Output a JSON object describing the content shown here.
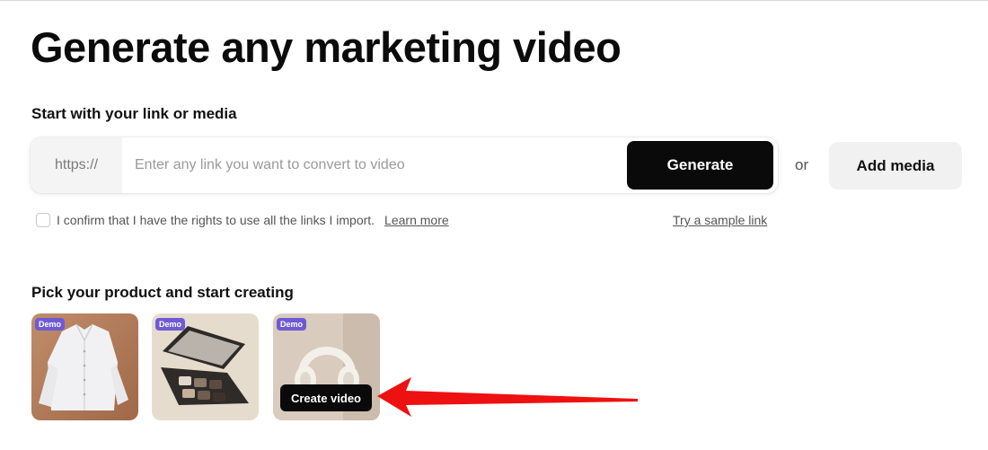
{
  "page": {
    "title": "Generate any marketing video"
  },
  "link_section": {
    "label": "Start with your link or media",
    "prefix": "https://",
    "input_placeholder": "Enter any link you want to convert to video",
    "input_value": "",
    "generate_label": "Generate",
    "or_text": "or",
    "add_media_label": "Add media",
    "confirm_text": "I confirm that I have the rights to use all the links I import.",
    "learn_more_label": "Learn more",
    "sample_link_label": "Try a sample link"
  },
  "products": {
    "label": "Pick your product and start creating",
    "items": [
      {
        "name": "shirt",
        "badge": "Demo",
        "icon": "shirt-thumbnail"
      },
      {
        "name": "eyeshadow-palette",
        "badge": "Demo",
        "icon": "palette-thumbnail"
      },
      {
        "name": "headphones",
        "badge": "Demo",
        "icon": "headphones-thumbnail",
        "hover_button": "Create video"
      }
    ]
  },
  "colors": {
    "accent": "#0a0a0a",
    "badge": "#6f5ad6",
    "annotation_arrow": "#ee1111"
  }
}
